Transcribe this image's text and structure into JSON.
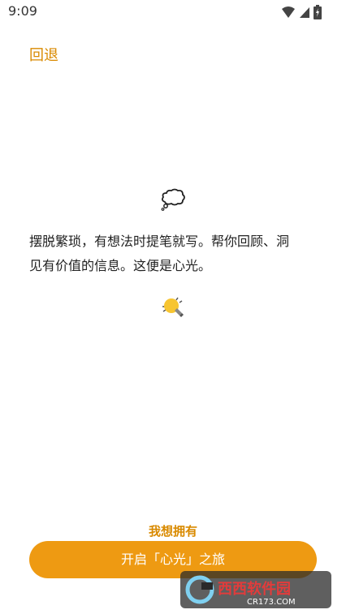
{
  "status_bar": {
    "time": "9:09"
  },
  "nav": {
    "back_label": "回退"
  },
  "intro": {
    "line1": "摆脱繁琐，有想法时提笔就写。帮你回顾、洞",
    "line2": "见有价值的信息。这便是心光。"
  },
  "actions": {
    "wish_label": "我想拥有",
    "start_label": "开启「心光」之旅"
  },
  "colors": {
    "accent": "#d98a00",
    "button": "#ee9a12",
    "bulb": "#f7c531"
  },
  "icons": {
    "wifi": "wifi-icon",
    "signal": "signal-icon",
    "battery": "battery-icon",
    "thought": "thought-bubble-icon",
    "bulb": "light-bulb-icon"
  },
  "watermark": {
    "brand": "西西软件园",
    "url": "CR173.COM"
  }
}
